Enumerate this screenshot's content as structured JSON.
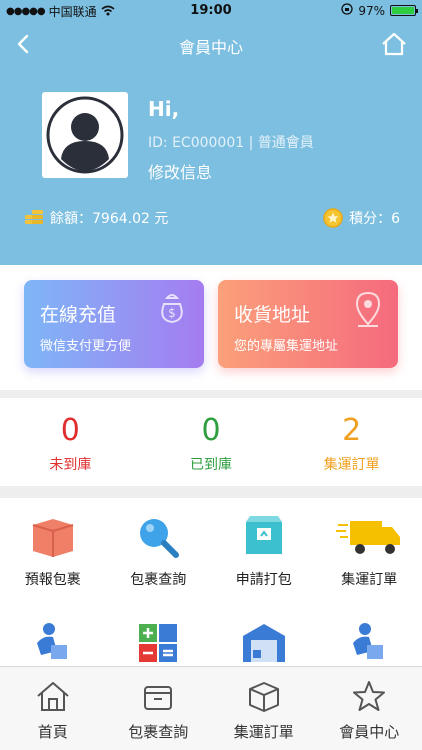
{
  "status_bar": {
    "carrier": "中国联通",
    "time": "19:00",
    "battery": "97%"
  },
  "nav": {
    "title": "會員中心"
  },
  "profile": {
    "greeting": "Hi,",
    "member_id": "ID: EC000001 | 普通會員",
    "edit_label": "修改信息",
    "balance": "餘額：7964.02 元",
    "points": "積分：6"
  },
  "cards": [
    {
      "title": "在線充值",
      "subtitle": "微信支付更方便"
    },
    {
      "title": "收貨地址",
      "subtitle": "您的專屬集運地址"
    }
  ],
  "stats": [
    {
      "value": "0",
      "label": "未到庫",
      "color": "#e02e2e"
    },
    {
      "value": "0",
      "label": "已到庫",
      "color": "#2e9e3e"
    },
    {
      "value": "2",
      "label": "集運訂單",
      "color": "#f0a020"
    }
  ],
  "grid": [
    {
      "label": "預報包裹",
      "icon": "box-icon"
    },
    {
      "label": "包裹查詢",
      "icon": "magnifier-icon"
    },
    {
      "label": "申請打包",
      "icon": "package-icon"
    },
    {
      "label": "集運訂單",
      "icon": "truck-icon"
    },
    {
      "label": "",
      "icon": "person-box-icon"
    },
    {
      "label": "",
      "icon": "calculator-icon"
    },
    {
      "label": "",
      "icon": "warehouse-icon"
    },
    {
      "label": "",
      "icon": "person-box-icon"
    }
  ],
  "tabbar": [
    {
      "label": "首頁",
      "icon": "home-icon"
    },
    {
      "label": "包裹查詢",
      "icon": "box-outline-icon"
    },
    {
      "label": "集運訂單",
      "icon": "parcel-icon"
    },
    {
      "label": "會員中心",
      "icon": "star-icon"
    }
  ]
}
